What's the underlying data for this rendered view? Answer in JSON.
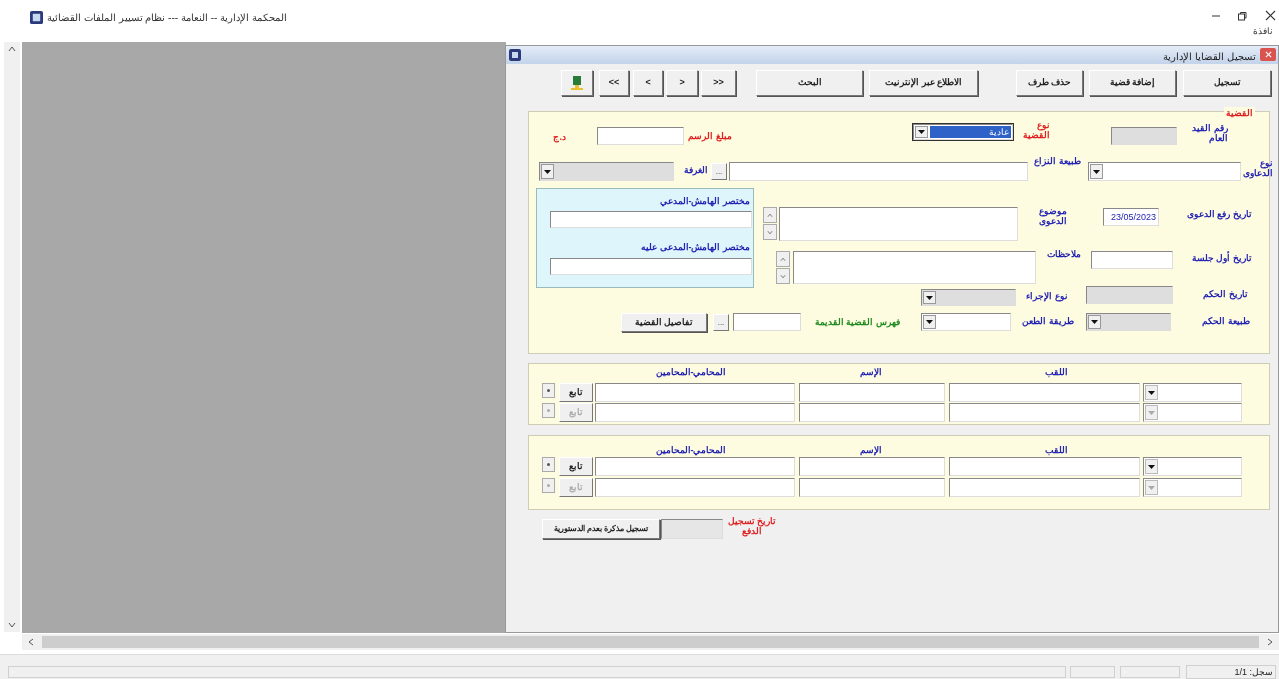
{
  "window": {
    "title": "المحكمة الإدارية -- النعامة --- نظام تسيير الملفات القضائية",
    "menu": [
      "نافذة"
    ]
  },
  "child_window": {
    "title": "تسجيل القضايا الإدارية",
    "toolbar": [
      {
        "kind": "text",
        "label": "تسجيل"
      },
      {
        "kind": "text",
        "label": "إضافة قضية"
      },
      {
        "kind": "text",
        "label": "حذف طرف"
      },
      {
        "kind": "text",
        "label": "الاطلاع عبر الإنترنيت"
      },
      {
        "kind": "text",
        "label": "البحث"
      },
      {
        "kind": "text",
        "label": "<<"
      },
      {
        "kind": "text",
        "label": "<"
      },
      {
        "kind": "text",
        "label": ">"
      },
      {
        "kind": "text",
        "label": ">>"
      },
      {
        "kind": "icon"
      }
    ],
    "case_panel": {
      "legend": "القضية",
      "fields": [
        {
          "label": "رقم القيد العام",
          "color": "#2323b4",
          "kind": "text",
          "disabled": true,
          "focused": false
        },
        {
          "label": "نوع القضية",
          "color": "#e02020",
          "kind": "combo",
          "disabled": false,
          "focused": true,
          "value": "عادية"
        },
        {
          "label": "مبلغ الرسم",
          "color": "#e02020",
          "kind": "text",
          "disabled": false,
          "focused": false,
          "unit": "د.ج"
        },
        {
          "label": "نوع الدعاوى",
          "color": "#2323b4",
          "kind": "combo",
          "disabled": false,
          "focused": false
        },
        {
          "label": "طبيعة النزاع",
          "color": "#2323b4",
          "kind": "text",
          "disabled": false,
          "focused": false,
          "browse": "..."
        },
        {
          "label": "الغرفة",
          "color": "#2323b4",
          "kind": "combo",
          "disabled": true,
          "focused": false
        },
        {
          "label": "تاريخ رفع الدعوى",
          "color": "#2323b4",
          "kind": "text",
          "disabled": false,
          "focused": false,
          "value": "23/05/2023"
        },
        {
          "label": "موضوع الدعوى",
          "color": "#2323b4",
          "kind": "memo",
          "disabled": false,
          "focused": false
        },
        {
          "label": "تاريخ أول جلسة",
          "color": "#2323b4",
          "kind": "text",
          "disabled": false,
          "focused": false
        },
        {
          "label": "ملاحظات",
          "color": "#2323b4",
          "kind": "memo",
          "disabled": false,
          "focused": false
        },
        {
          "label": "تاريخ الحكم",
          "color": "#2323b4",
          "kind": "text",
          "disabled": true,
          "focused": false
        },
        {
          "label": "نوع الإجراء",
          "color": "#2323b4",
          "kind": "combo",
          "disabled": true,
          "focused": false
        },
        {
          "label": "طبيعة الحكم",
          "color": "#2323b4",
          "kind": "combo",
          "disabled": true,
          "focused": false
        },
        {
          "label": "طريقة الطعن",
          "color": "#2323b4",
          "kind": "combo",
          "disabled": false,
          "focused": false
        },
        {
          "label": "فهرس القضية القديمة",
          "color": "#1f8a1f",
          "kind": "text",
          "disabled": false,
          "focused": false,
          "browse": "..."
        }
      ],
      "details_button": "تفاصيل القضية",
      "margin_summary": [
        {
          "label": "مختصر الهامش-المدعي"
        },
        {
          "label": "مختصر الهامش-المدعى عليه"
        }
      ]
    },
    "parties": [
      {
        "columns": [
          "اللقب",
          "الإسم",
          "المحامي-المحامين"
        ],
        "rows": [
          {
            "button": "تابع",
            "disabled": false
          },
          {
            "button": "تابع",
            "disabled": true
          }
        ]
      },
      {
        "columns": [
          "اللقب",
          "الإسم",
          "المحامي-المحامين"
        ],
        "rows": [
          {
            "button": "تابع",
            "disabled": false
          },
          {
            "button": "تابع",
            "disabled": true
          }
        ]
      }
    ],
    "filing": {
      "label": "تاريخ تسجيل الدفع",
      "button": "تسجيل مذكرة بعدم الدستورية"
    }
  },
  "status_bar": {
    "record": "سجل: 1/1"
  }
}
